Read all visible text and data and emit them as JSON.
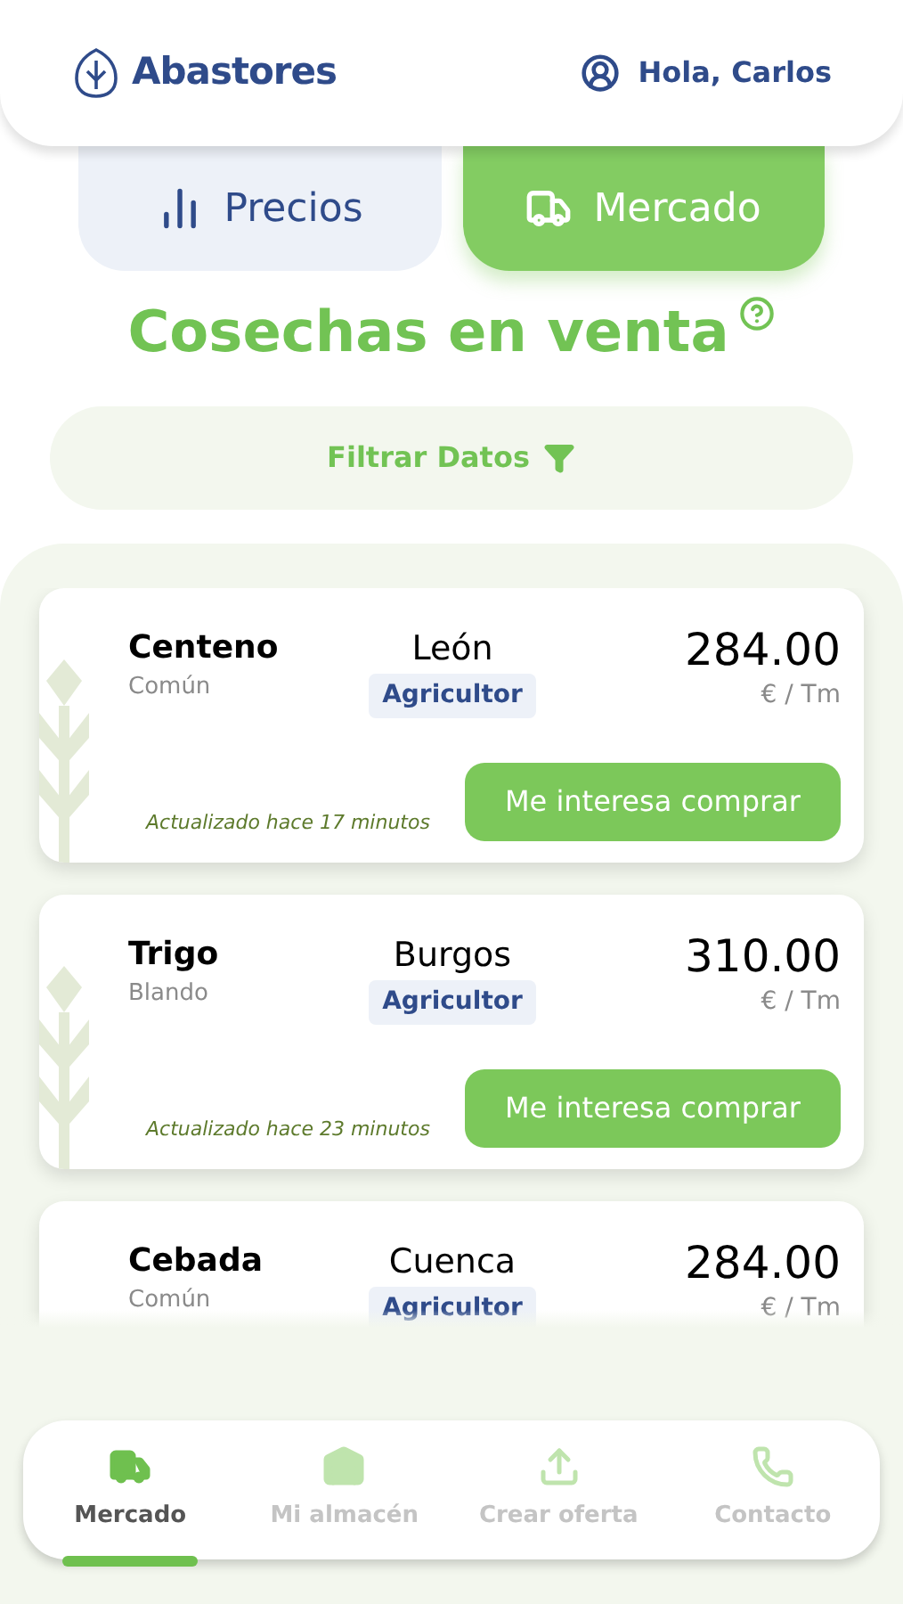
{
  "header": {
    "brand": "Abastores",
    "greeting": "Hola, Carlos"
  },
  "tabs": [
    {
      "label": "Precios",
      "kind": "chart",
      "selected": false
    },
    {
      "label": "Mercado",
      "kind": "truck",
      "selected": true
    }
  ],
  "title": "Cosechas en venta",
  "filter": {
    "label": "Filtrar Datos"
  },
  "offers": [
    {
      "name": "Centeno",
      "variety": "Común",
      "location": "León",
      "badge": "Agricultor",
      "price": "284.00",
      "unit": "€ / Tm",
      "updated": "Actualizado hace 17 minutos",
      "action": "Me interesa comprar"
    },
    {
      "name": "Trigo",
      "variety": "Blando",
      "location": "Burgos",
      "badge": "Agricultor",
      "price": "310.00",
      "unit": "€ / Tm",
      "updated": "Actualizado hace 23 minutos",
      "action": "Me interesa comprar"
    },
    {
      "name": "Cebada",
      "variety": "Común",
      "location": "Cuenca",
      "badge": "Agricultor",
      "price": "284.00",
      "unit": "€ / Tm"
    }
  ],
  "nav": [
    {
      "label": "Mercado",
      "kind": "truck",
      "selected": true
    },
    {
      "label": "Mi almacén",
      "kind": "warehouse",
      "selected": false
    },
    {
      "label": "Crear oferta",
      "kind": "upload",
      "selected": false
    },
    {
      "label": "Contacto",
      "kind": "phone",
      "selected": false
    }
  ]
}
